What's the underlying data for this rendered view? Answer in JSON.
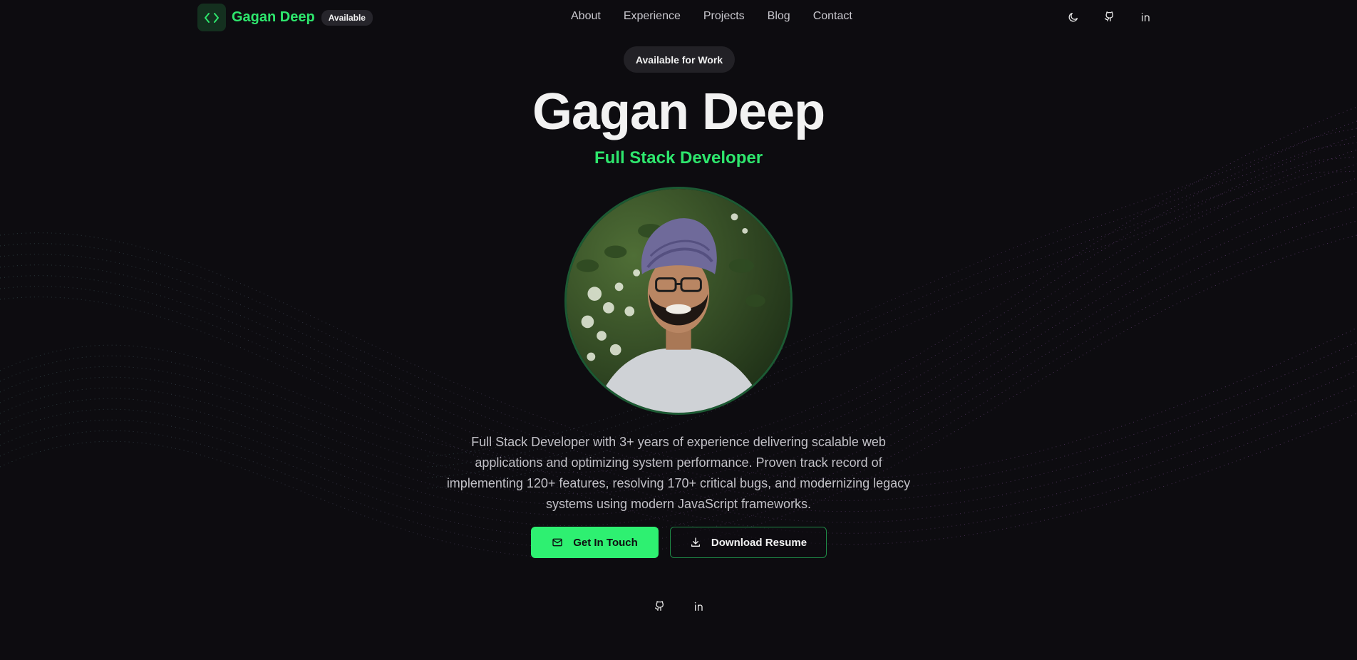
{
  "header": {
    "logo_icon": "code-brackets-icon",
    "name": "Gagan Deep",
    "status_badge": "Available",
    "nav": [
      "About",
      "Experience",
      "Projects",
      "Blog",
      "Contact"
    ],
    "icons": [
      "moon-icon",
      "github-icon",
      "linkedin-icon"
    ]
  },
  "hero": {
    "badge": "Available for Work",
    "title": "Gagan Deep",
    "subtitle": "Full Stack Developer",
    "bio": "Full Stack Developer with 3+ years of experience delivering scalable web applications and optimizing system performance. Proven track record of implementing 120+ features, resolving 170+ critical bugs, and modernizing legacy systems using modern JavaScript frameworks.",
    "primary_button": {
      "label": "Get In Touch",
      "icon": "mail-icon"
    },
    "secondary_button": {
      "label": "Download Resume",
      "icon": "download-icon"
    }
  },
  "footer_icons": [
    "github-icon",
    "linkedin-icon"
  ],
  "colors": {
    "background": "#0d0c10",
    "accent": "#2ee66d",
    "text": "#f2f2f2",
    "muted_text": "#c2c1c7",
    "wave_purple": "#7b4a8f",
    "wave_teal": "#3a5a5a"
  }
}
